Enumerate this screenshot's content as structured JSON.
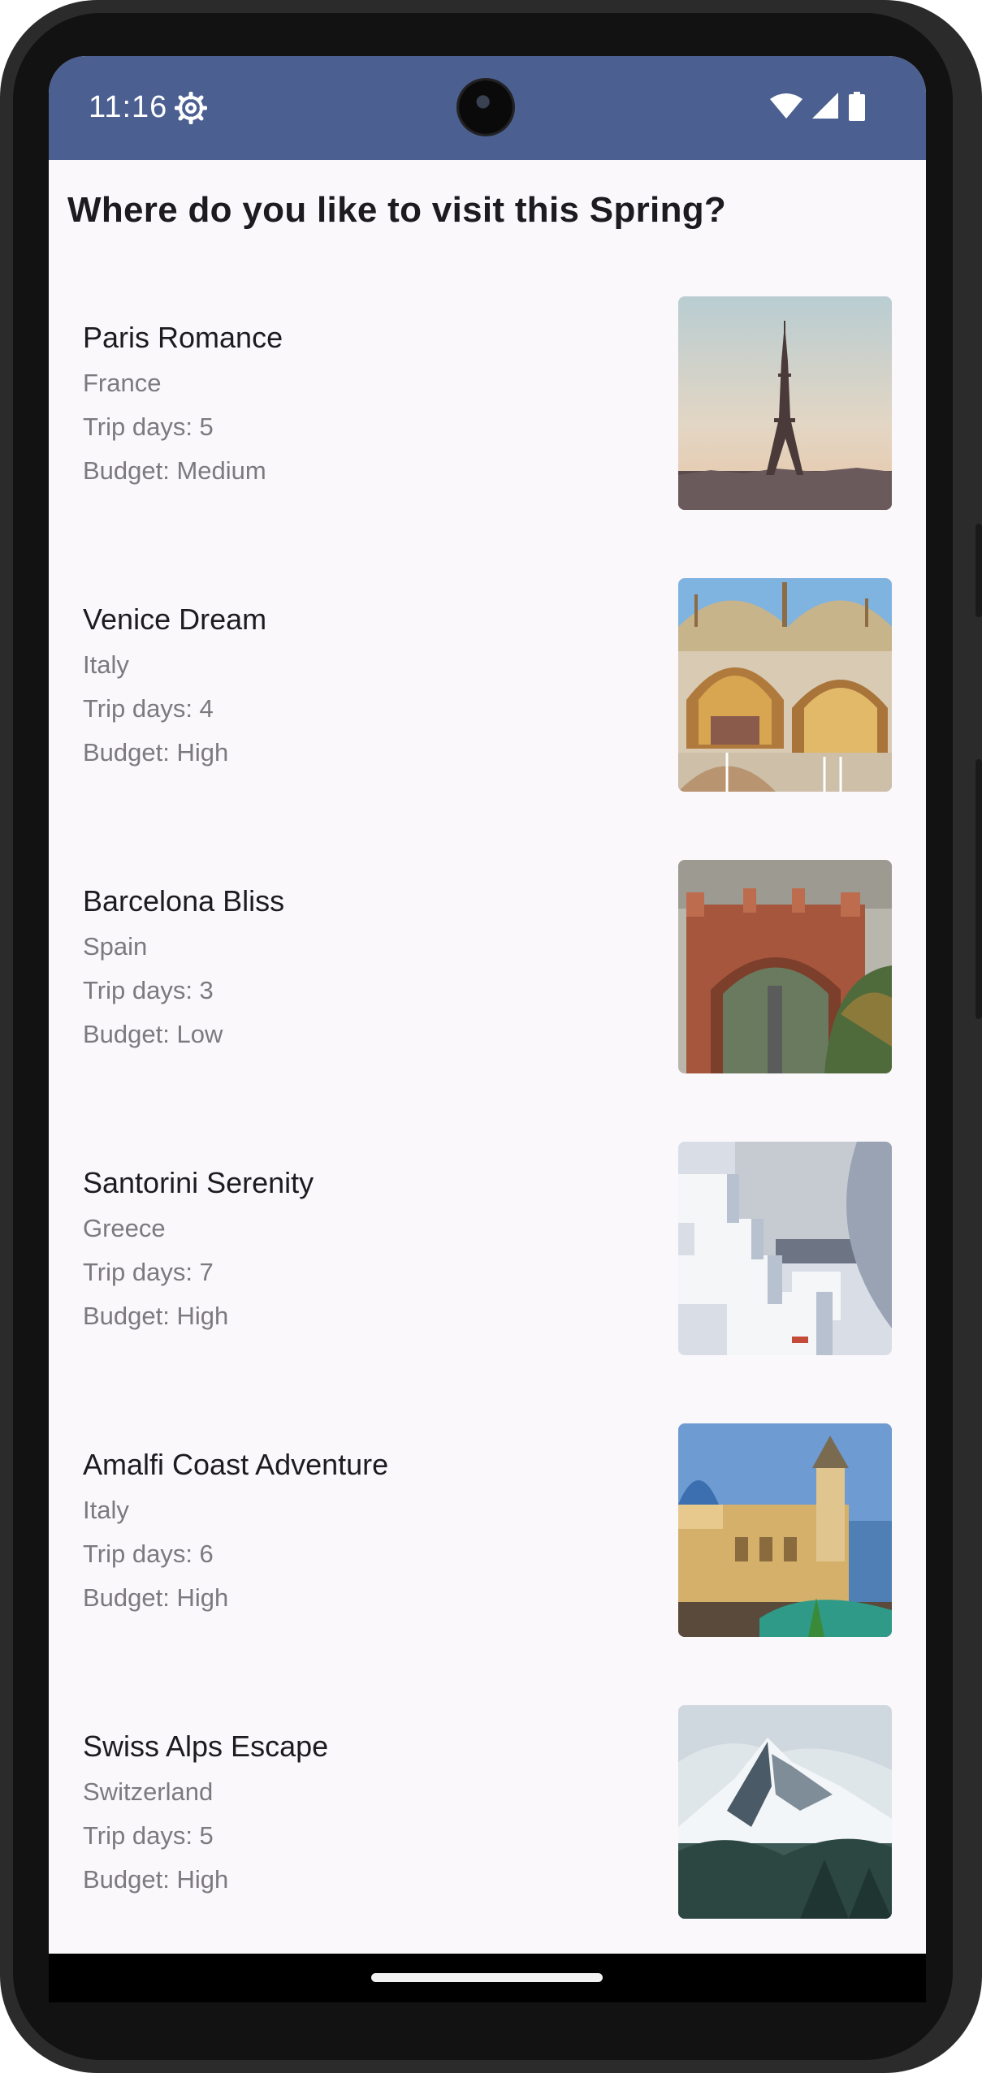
{
  "status_bar": {
    "time": "11:16",
    "icons": [
      "gear-icon",
      "wifi-icon",
      "signal-icon",
      "battery-icon"
    ],
    "color": "#4b5f91"
  },
  "page": {
    "title": "Where do you like to visit this Spring?"
  },
  "trips": [
    {
      "name": "Paris Romance",
      "country": "France",
      "days": "Trip days: 5",
      "budget": "Budget: Medium",
      "photo": "eiffel-tower-photo"
    },
    {
      "name": "Venice Dream",
      "country": "Italy",
      "days": "Trip days: 4",
      "budget": "Budget: High",
      "photo": "st-marks-basilica-photo"
    },
    {
      "name": "Barcelona Bliss",
      "country": "Spain",
      "days": "Trip days: 3",
      "budget": "Budget: Low",
      "photo": "arc-de-triomf-photo"
    },
    {
      "name": "Santorini Serenity",
      "country": "Greece",
      "days": "Trip days: 7",
      "budget": "Budget: High",
      "photo": "santorini-houses-photo"
    },
    {
      "name": "Amalfi Coast Adventure",
      "country": "Italy",
      "days": "Trip days: 6",
      "budget": "Budget: High",
      "photo": "positano-church-photo"
    },
    {
      "name": "Swiss Alps Escape",
      "country": "Switzerland",
      "days": "Trip days: 5",
      "budget": "Budget: High",
      "photo": "matterhorn-photo"
    }
  ]
}
